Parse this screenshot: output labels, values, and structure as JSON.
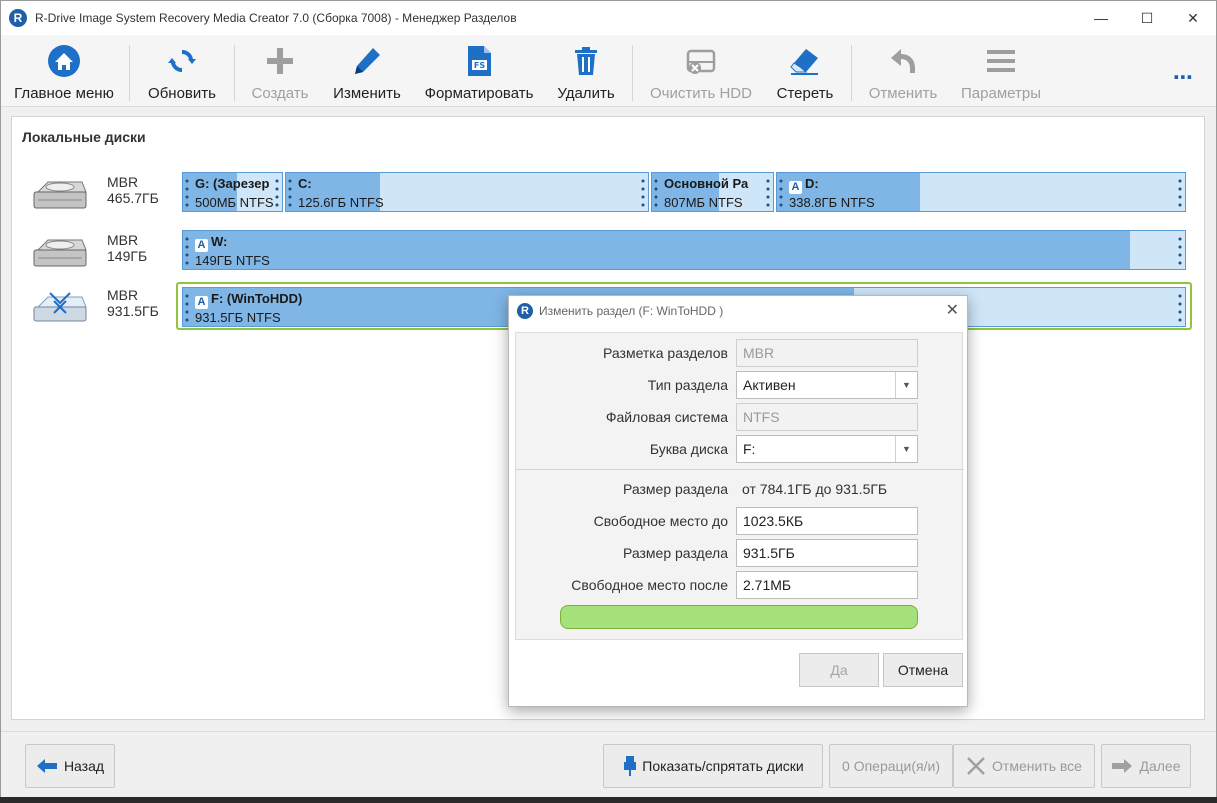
{
  "window": {
    "title": "R-Drive Image System Recovery Media Creator 7.0 (Сборка 7008) - Менеджер Разделов",
    "app_icon": "R",
    "minimize": "—",
    "maximize": "☐",
    "close": "✕"
  },
  "toolbar": {
    "main_menu": "Главное меню",
    "refresh": "Обновить",
    "create": "Создать",
    "modify": "Изменить",
    "format": "Форматировать",
    "delete": "Удалить",
    "clear_hdd": "Очистить HDD",
    "erase": "Стереть",
    "undo": "Отменить",
    "params": "Параметры",
    "more": "⋯"
  },
  "content": {
    "section_title": "Локальные диски",
    "disks": [
      {
        "scheme": "MBR",
        "size": "465.7ГБ",
        "partitions": [
          {
            "name": "G: (Зарезер",
            "info": "500МБ NTFS",
            "fill": 0.55,
            "badge": false
          },
          {
            "name": "C:",
            "info": "125.6ГБ NTFS",
            "fill": 0.26,
            "badge": false
          },
          {
            "name": "Основной Ра",
            "info": "807МБ NTFS",
            "fill": 0.55,
            "badge": false
          },
          {
            "name": "D:",
            "info": "338.8ГБ NTFS",
            "fill": 0.35,
            "badge": true
          }
        ]
      },
      {
        "scheme": "MBR",
        "size": "149ГБ",
        "partitions": [
          {
            "name": "W:",
            "info": "149ГБ NTFS",
            "fill": 0.945,
            "badge": true
          }
        ]
      },
      {
        "scheme": "MBR",
        "size": "931.5ГБ",
        "partitions": [
          {
            "name": "F: (WinToHDD)",
            "info": "931.5ГБ NTFS",
            "fill": 0.67,
            "badge": true
          }
        ]
      }
    ],
    "badge_letter": "A"
  },
  "dialog": {
    "title": "Изменить раздел (F: WinToHDD )",
    "close": "✕",
    "labels": {
      "partition_scheme": "Разметка разделов",
      "partition_type": "Тип раздела",
      "file_system": "Файловая система",
      "drive_letter": "Буква диска",
      "partition_size_range": "Размер раздела",
      "free_before": "Свободное место до",
      "partition_size": "Размер раздела",
      "free_after": "Свободное место после"
    },
    "values": {
      "partition_scheme": "MBR",
      "partition_type": "Активен",
      "file_system": "NTFS",
      "drive_letter": "F:",
      "range": "от  784.1ГБ  до  931.5ГБ",
      "free_before": "1023.5КБ",
      "partition_size": "931.5ГБ",
      "free_after": "2.71МБ"
    },
    "ok": "Да",
    "cancel": "Отмена"
  },
  "bottom": {
    "back": "Назад",
    "show_hide": "Показать/спрятать диски",
    "operations": "0 Операци(я/и)",
    "cancel_all": "Отменить все",
    "next": "Далее"
  },
  "colors": {
    "accent": "#1e5fa8",
    "partition_fill": "#7fb6e6",
    "partition_bg": "#cfe6f8",
    "selected_border": "#8fc63f",
    "slider": "#a6e07a"
  }
}
